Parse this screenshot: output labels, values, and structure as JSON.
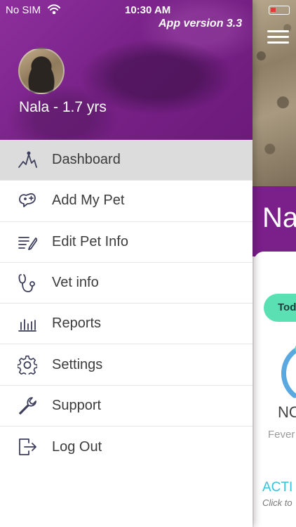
{
  "status_bar": {
    "carrier": "No SIM",
    "time": "10:30 AM"
  },
  "app_version": "App version 3.3",
  "pet": {
    "name_age": "Nala - 1.7 yrs"
  },
  "menu": {
    "active_index": 0,
    "items": [
      {
        "label": "Dashboard",
        "icon": "dashboard-icon"
      },
      {
        "label": "Add My Pet",
        "icon": "add-pet-icon"
      },
      {
        "label": "Edit Pet Info",
        "icon": "edit-icon"
      },
      {
        "label": "Vet info",
        "icon": "stethoscope-icon"
      },
      {
        "label": "Reports",
        "icon": "bar-chart-icon"
      },
      {
        "label": "Settings",
        "icon": "gear-icon"
      },
      {
        "label": "Support",
        "icon": "wrench-icon"
      },
      {
        "label": "Log Out",
        "icon": "logout-icon"
      }
    ]
  },
  "behind_page": {
    "title_fragment": "Na",
    "tab_fragment": "Tod",
    "status_fragment": "NO",
    "sub_fragment": "Fever",
    "section_fragment": "ACTI",
    "hint_fragment": "Click to"
  },
  "colors": {
    "brand_purple": "#7b1f8a",
    "accent_green": "#5be0b4",
    "accent_cyan": "#38c3dd",
    "active_row": "#dcdcdc"
  }
}
